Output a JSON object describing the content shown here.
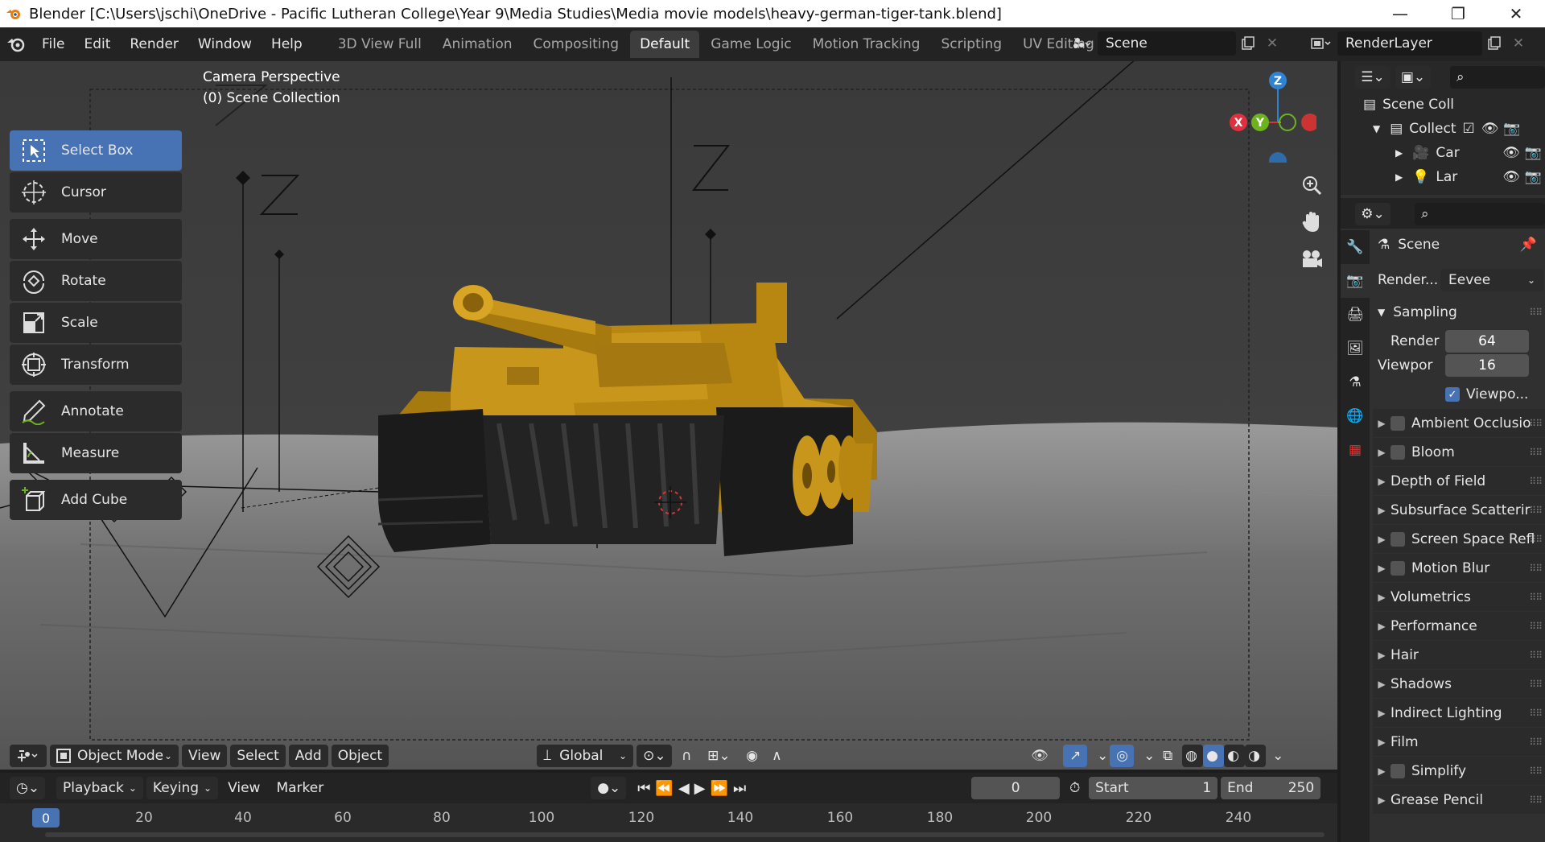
{
  "title": "Blender [C:\\Users\\jschi\\OneDrive - Pacific Lutheran College\\Year 9\\Media Studies\\Media movie models\\heavy-german-tiger-tank.blend]",
  "window_controls": {
    "minimize": "—",
    "restore": "❐",
    "close": "✕"
  },
  "menu": [
    "File",
    "Edit",
    "Render",
    "Window",
    "Help"
  ],
  "workspaces": [
    "3D View Full",
    "Animation",
    "Compositing",
    "Default",
    "Game Logic",
    "Motion Tracking",
    "Scripting",
    "UV Editing"
  ],
  "active_workspace": "Default",
  "scene": "Scene",
  "view_layer": "RenderLayer",
  "tools": [
    "Select Box",
    "Cursor",
    "Move",
    "Rotate",
    "Scale",
    "Transform",
    "Annotate",
    "Measure",
    "Add Cube"
  ],
  "active_tool": "Select Box",
  "viewport": {
    "perspective": "Camera Perspective",
    "collection": "(0) Scene Collection"
  },
  "gizmo": {
    "z": "Z",
    "y": "Y",
    "x": "X"
  },
  "viewport_header": {
    "mode": "Object Mode",
    "menus": [
      "View",
      "Select",
      "Add",
      "Object"
    ],
    "orientation": "Global"
  },
  "timeline": {
    "menus": [
      "Playback",
      "Keying",
      "View",
      "Marker"
    ],
    "current_frame": "0",
    "start_label": "Start",
    "start": "1",
    "end_label": "End",
    "end": "250",
    "ticks": [
      "0",
      "20",
      "40",
      "60",
      "80",
      "100",
      "120",
      "140",
      "160",
      "180",
      "200",
      "220",
      "240"
    ]
  },
  "outliner": {
    "root": "Scene Coll",
    "collection": "Collect",
    "items": [
      "Car",
      "Lar"
    ]
  },
  "properties": {
    "context": "Scene",
    "render_engine_label": "Render...",
    "render_engine": "Eevee",
    "sampling": {
      "title": "Sampling",
      "render_label": "Render",
      "render": "64",
      "viewport_label": "Viewpor",
      "viewport": "16",
      "viewport_denoise": "Viewpo..."
    },
    "panels": [
      {
        "label": "Ambient Occlusio",
        "checkbox": true
      },
      {
        "label": "Bloom",
        "checkbox": true
      },
      {
        "label": "Depth of Field",
        "checkbox": false
      },
      {
        "label": "Subsurface Scatterir",
        "checkbox": false
      },
      {
        "label": "Screen Space Refl",
        "checkbox": true
      },
      {
        "label": "Motion Blur",
        "checkbox": true
      },
      {
        "label": "Volumetrics",
        "checkbox": false
      },
      {
        "label": "Performance",
        "checkbox": false
      },
      {
        "label": "Hair",
        "checkbox": false
      },
      {
        "label": "Shadows",
        "checkbox": false
      },
      {
        "label": "Indirect Lighting",
        "checkbox": false
      },
      {
        "label": "Film",
        "checkbox": false
      },
      {
        "label": "Simplify",
        "checkbox": true
      },
      {
        "label": "Grease Pencil",
        "checkbox": false
      }
    ]
  },
  "colors": {
    "accent": "#4772b3",
    "tank": "#c8961a",
    "x_axis": "#e0303f",
    "y_axis": "#6db31d",
    "z_axis": "#2f83d3"
  }
}
